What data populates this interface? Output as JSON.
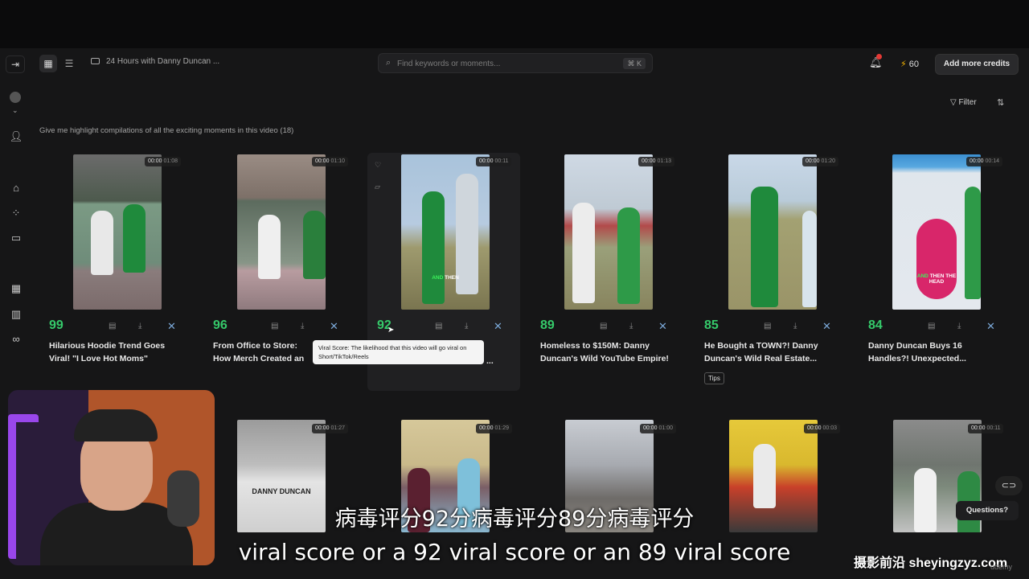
{
  "topbar": {
    "collapse_icon": "sidebar-collapse-icon",
    "grid_icon": "grid-view-icon",
    "list_icon": "list-view-icon",
    "video_title": "24 Hours with Danny Duncan ...",
    "search_placeholder": "Find keywords or moments...",
    "search_shortcut": "⌘ K",
    "credits_count": "60",
    "add_credits_label": "Add more credits"
  },
  "sidebar": {
    "items": [
      "home-icon",
      "apps-icon",
      "folder-icon",
      "calendar-icon",
      "analytics-icon",
      "link-icon"
    ]
  },
  "content": {
    "filter_label": "Filter",
    "prompt": "Give me highlight compilations of all the exciting moments in this video",
    "count": "(18)"
  },
  "clips": [
    {
      "time_start": "00:00",
      "time_end": "01:08",
      "score": "99",
      "title": "Hilarious Hoodie Trend Goes Viral! \"I Love Hot Moms\""
    },
    {
      "time_start": "00:00",
      "time_end": "01:10",
      "score": "96",
      "title": "From Office to Store: How Merch Created an Ice C..."
    },
    {
      "time_start": "00:00",
      "time_end": "00:11",
      "score": "92",
      "title": "...",
      "caption": "AND THEN"
    },
    {
      "time_start": "00:00",
      "time_end": "01:13",
      "score": "89",
      "title": "Homeless to $150M: Danny Duncan's Wild YouTube Empire!"
    },
    {
      "time_start": "00:00",
      "time_end": "01:20",
      "score": "85",
      "title": "He Bought a TOWN?! Danny Duncan's Wild Real Estate...",
      "tag": "Tips"
    },
    {
      "time_start": "00:00",
      "time_end": "00:14",
      "score": "84",
      "title": "Danny Duncan Buys 16 Handles?! Unexpected...",
      "caption": "AND THEN THE HEAD"
    }
  ],
  "clips_row2": [
    {
      "time_start": "00:00",
      "time_end": "01:27",
      "sign": "DANNY DUNCAN"
    },
    {
      "time_start": "00:00",
      "time_end": "01:29"
    },
    {
      "time_start": "00:00",
      "time_end": "01:00"
    },
    {
      "time_start": "00:00",
      "time_end": "00:03"
    },
    {
      "time_start": "00:00",
      "time_end": "00:11"
    }
  ],
  "tooltip": "Viral Score: The likelihood that this video will go viral on Short/TikTok/Reels",
  "questions_label": "Questions?",
  "subtitle_zh": "病毒评分92分病毒评分89分病毒评分",
  "subtitle_en": "viral score or a 92 viral score or an 89 viral score",
  "watermark": "摄影前沿 sheyingzyz.com",
  "footer_brand": "udemy",
  "colors": {
    "score": "#35c96a",
    "accent": "#f5b400",
    "background": "#161617"
  }
}
